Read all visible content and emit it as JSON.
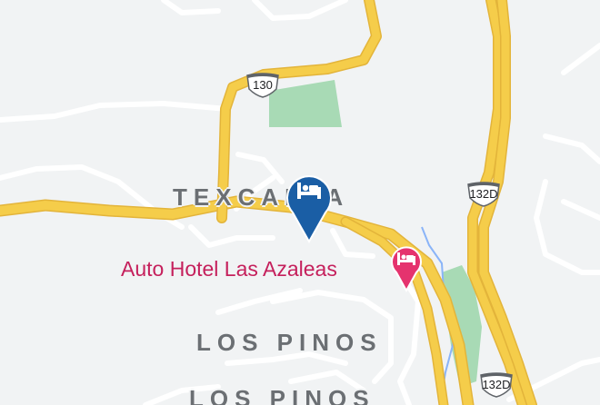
{
  "map": {
    "areas": [
      {
        "id": "texcalpa",
        "label": "TEXCALPA"
      },
      {
        "id": "los-pinos-1",
        "label": "LOS PINOS"
      },
      {
        "id": "los-pinos-2",
        "label": "LOS PINOS"
      }
    ],
    "poi": {
      "label": "Auto Hotel Las Azaleas",
      "icon": "bed-icon",
      "color": "#e5336e"
    },
    "selected_marker": {
      "icon": "bed-icon",
      "color": "#1a5ea5"
    },
    "routes": [
      {
        "id": "130",
        "label": "130"
      },
      {
        "id": "132d-a",
        "label": "132D"
      },
      {
        "id": "132d-b",
        "label": "132D"
      }
    ],
    "colors": {
      "highway": "#f5cd4a",
      "highway_edge": "#e3b43a",
      "park": "#a8dab5",
      "water": "#8ab4f8",
      "road": "#ffffff",
      "background": "#f1f3f4"
    }
  }
}
